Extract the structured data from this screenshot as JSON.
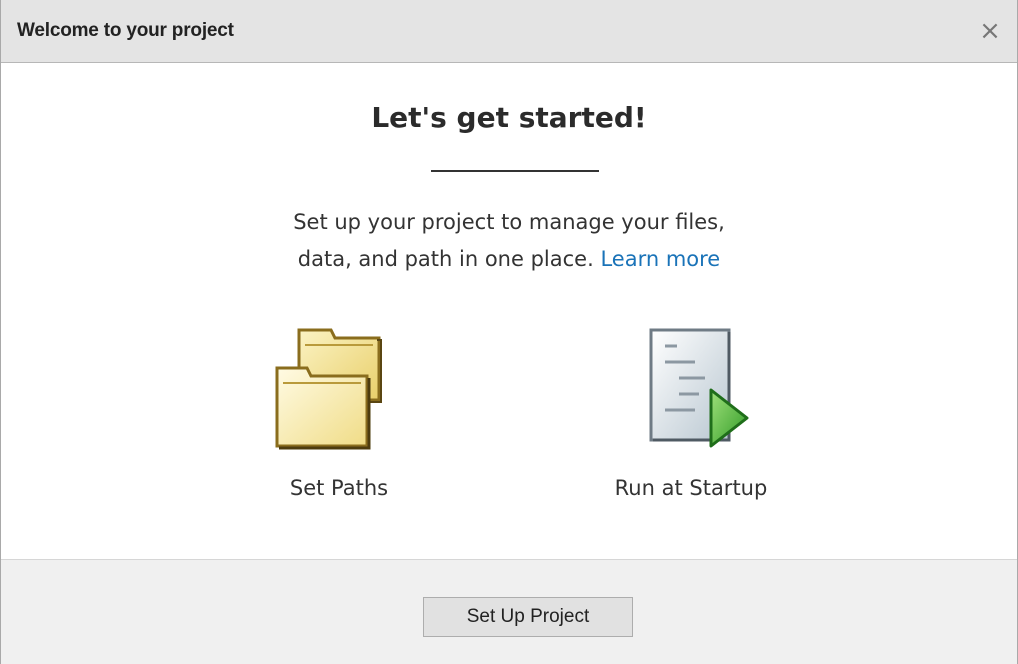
{
  "window": {
    "title": "Welcome to your project",
    "close_glyph": "×"
  },
  "main": {
    "heading": "Let's get started!",
    "description_line1": "Set up your project to manage your files,",
    "description_line2": "data, and path in one place.",
    "learn_more": "Learn more"
  },
  "actions": [
    {
      "label": "Set Paths",
      "icon": "folders-icon"
    },
    {
      "label": "Run at Startup",
      "icon": "run-script-icon"
    }
  ],
  "footer": {
    "setup_button": "Set Up Project"
  },
  "colors": {
    "titlebar_bg": "#e4e4e4",
    "link": "#1a73b8",
    "footer_bg": "#f0f0f0",
    "button_bg": "#e1e1e1"
  }
}
